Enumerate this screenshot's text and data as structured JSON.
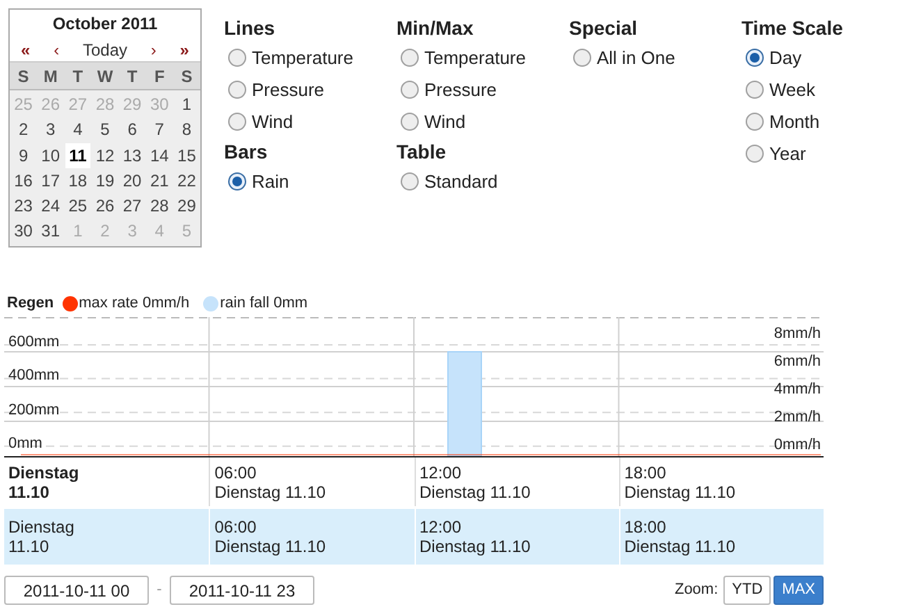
{
  "calendar": {
    "title": "October 2011",
    "nav": [
      "«",
      "‹",
      "Today",
      "›",
      "»"
    ],
    "weekdays": [
      "S",
      "M",
      "T",
      "W",
      "T",
      "F",
      "S"
    ],
    "weeks": [
      [
        {
          "day": "25",
          "muted": true,
          "selected": false
        },
        {
          "day": "26",
          "muted": true,
          "selected": false
        },
        {
          "day": "27",
          "muted": true,
          "selected": false
        },
        {
          "day": "28",
          "muted": true,
          "selected": false
        },
        {
          "day": "29",
          "muted": true,
          "selected": false
        },
        {
          "day": "30",
          "muted": true,
          "selected": false
        },
        {
          "day": "1",
          "muted": false,
          "selected": false
        }
      ],
      [
        {
          "day": "2",
          "muted": false,
          "selected": false
        },
        {
          "day": "3",
          "muted": false,
          "selected": false
        },
        {
          "day": "4",
          "muted": false,
          "selected": false
        },
        {
          "day": "5",
          "muted": false,
          "selected": false
        },
        {
          "day": "6",
          "muted": false,
          "selected": false
        },
        {
          "day": "7",
          "muted": false,
          "selected": false
        },
        {
          "day": "8",
          "muted": false,
          "selected": false
        }
      ],
      [
        {
          "day": "9",
          "muted": false,
          "selected": false
        },
        {
          "day": "10",
          "muted": false,
          "selected": false
        },
        {
          "day": "11",
          "muted": false,
          "selected": true
        },
        {
          "day": "12",
          "muted": false,
          "selected": false
        },
        {
          "day": "13",
          "muted": false,
          "selected": false
        },
        {
          "day": "14",
          "muted": false,
          "selected": false
        },
        {
          "day": "15",
          "muted": false,
          "selected": false
        }
      ],
      [
        {
          "day": "16",
          "muted": false,
          "selected": false
        },
        {
          "day": "17",
          "muted": false,
          "selected": false
        },
        {
          "day": "18",
          "muted": false,
          "selected": false
        },
        {
          "day": "19",
          "muted": false,
          "selected": false
        },
        {
          "day": "20",
          "muted": false,
          "selected": false
        },
        {
          "day": "21",
          "muted": false,
          "selected": false
        },
        {
          "day": "22",
          "muted": false,
          "selected": false
        }
      ],
      [
        {
          "day": "23",
          "muted": false,
          "selected": false
        },
        {
          "day": "24",
          "muted": false,
          "selected": false
        },
        {
          "day": "25",
          "muted": false,
          "selected": false
        },
        {
          "day": "26",
          "muted": false,
          "selected": false
        },
        {
          "day": "27",
          "muted": false,
          "selected": false
        },
        {
          "day": "28",
          "muted": false,
          "selected": false
        },
        {
          "day": "29",
          "muted": false,
          "selected": false
        }
      ],
      [
        {
          "day": "30",
          "muted": false,
          "selected": false
        },
        {
          "day": "31",
          "muted": false,
          "selected": false
        },
        {
          "day": "1",
          "muted": true,
          "selected": false
        },
        {
          "day": "2",
          "muted": true,
          "selected": false
        },
        {
          "day": "3",
          "muted": true,
          "selected": false
        },
        {
          "day": "4",
          "muted": true,
          "selected": false
        },
        {
          "day": "5",
          "muted": true,
          "selected": false
        }
      ]
    ]
  },
  "option_columns": [
    {
      "groups": [
        {
          "title": "Lines",
          "items": [
            {
              "label": "Temperature",
              "selected": false
            },
            {
              "label": "Pressure",
              "selected": false
            },
            {
              "label": "Wind",
              "selected": false
            }
          ]
        },
        {
          "title": "Bars",
          "items": [
            {
              "label": "Rain",
              "selected": true
            }
          ]
        }
      ]
    },
    {
      "groups": [
        {
          "title": "Min/Max",
          "items": [
            {
              "label": "Temperature",
              "selected": false
            },
            {
              "label": "Pressure",
              "selected": false
            },
            {
              "label": "Wind",
              "selected": false
            }
          ]
        },
        {
          "title": "Table",
          "items": [
            {
              "label": "Standard",
              "selected": false
            }
          ]
        }
      ]
    },
    {
      "groups": [
        {
          "title": "Special",
          "items": [
            {
              "label": "All in One",
              "selected": false
            }
          ]
        }
      ]
    },
    {
      "groups": [
        {
          "title": "Time Scale",
          "items": [
            {
              "label": "Day",
              "selected": true
            },
            {
              "label": "Week",
              "selected": false
            },
            {
              "label": "Month",
              "selected": false
            },
            {
              "label": "Year",
              "selected": false
            }
          ]
        }
      ]
    }
  ],
  "chart": {
    "title": "Regen",
    "legend": [
      {
        "label": "max rate 0mm/h",
        "color": "#ff3300"
      }
    ],
    "rate_axis_labels": [
      "8mm/h",
      "6mm/h",
      "4mm/h",
      "2mm/h",
      "0mm/h"
    ],
    "amount_axis_labels": [
      "600mm",
      "400mm",
      "200mm",
      "0mm"
    ],
    "series": [
      {
        "name": "rain fall 0mm",
        "color": "#c6e3fb"
      }
    ]
  },
  "table": {
    "rows": [
      {
        "highlighted": false,
        "cells": [
          {
            "time": "Dienstag",
            "date": "11.10",
            "bold": true
          },
          {
            "time": "06:00",
            "date": "Dienstag 11.10",
            "bold": false
          },
          {
            "time": "12:00",
            "date": "Dienstag 11.10",
            "bold": false
          },
          {
            "time": "18:00",
            "date": "Dienstag 11.10",
            "bold": false
          }
        ]
      },
      {
        "highlighted": true,
        "cells": [
          {
            "time": "Dienstag",
            "date": "11.10",
            "bold": false
          },
          {
            "time": "06:00",
            "date": "Dienstag 11.10",
            "bold": false
          },
          {
            "time": "12:00",
            "date": "Dienstag 11.10",
            "bold": false
          },
          {
            "time": "18:00",
            "date": "Dienstag 11.10",
            "bold": false
          }
        ]
      }
    ]
  },
  "range": {
    "from": "2011-10-11 00",
    "separator": "-",
    "to": "2011-10-11 23"
  },
  "zoom": {
    "label": "Zoom:",
    "buttons": [
      {
        "label": "YTD",
        "selected": false
      },
      {
        "label": "MAX",
        "selected": true
      }
    ]
  }
}
